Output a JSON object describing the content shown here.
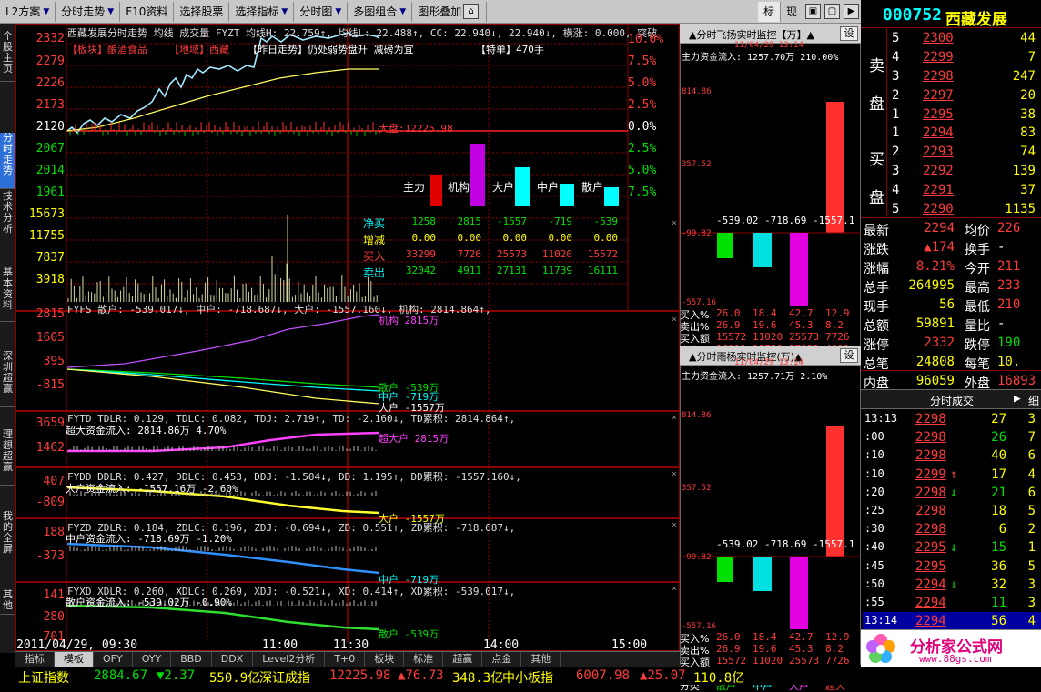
{
  "toolbar": {
    "items": [
      "L2方案",
      "分时走势",
      "F10资料",
      "选择股票",
      "选择指标",
      "分时图",
      "多图组合",
      "图形叠加"
    ],
    "right": [
      "标",
      "现"
    ]
  },
  "lefttabs": [
    "个股主页",
    "分时走势",
    "技术分析",
    "基本资料",
    "深圳超赢",
    "理想超赢",
    "我的全屏",
    "其他"
  ],
  "chart": {
    "header": "西藏发展分时走势  均线  成交量  FYZT  均线H: 22.759↑, 均线L: 22.488↑, CC: 22.940↓, 22.940↓, 横涨: 0.000, 突破",
    "tags": [
      "【板块】酿酒食品",
      "【地域】西藏",
      "【昨日走势】仍处弱势盘升  减磅为宜",
      "【特单】470手"
    ],
    "ylabels": [
      "2332",
      "2279",
      "2226",
      "2173",
      "2120",
      "2067",
      "2014",
      "1961"
    ],
    "pct": [
      "10.0%",
      "7.5%",
      "5.0%",
      "2.5%",
      "0.0%",
      "2.5%",
      "5.0%",
      "7.5%"
    ],
    "dapan": "大盘:12225.98",
    "vol_labels": [
      "15673",
      "11755",
      "7837",
      "3918"
    ],
    "bar_labels": [
      "主力",
      "机构",
      "大户",
      "中户",
      "散户"
    ],
    "flow": {
      "rows": [
        {
          "label": "净买",
          "vals": [
            "1258",
            "2815",
            "-1557",
            "-719",
            "-539"
          ]
        },
        {
          "label": "增减",
          "vals": [
            "0.00",
            "0.00",
            "0.00",
            "0.00",
            "0.00"
          ]
        },
        {
          "label": "买入",
          "vals": [
            "33299",
            "7726",
            "25573",
            "11020",
            "15572"
          ]
        },
        {
          "label": "卖出",
          "vals": [
            "32042",
            "4911",
            "27131",
            "11739",
            "16111"
          ]
        }
      ]
    },
    "times": [
      "2011/04/29, 09:30",
      "11:00",
      "11:30",
      "14:00",
      "15:00"
    ]
  },
  "ind1": {
    "header": "FYFS 散户: -539.017↓, 中户: -718.687↓, 大户: -1557.160↓, 机构: 2814.864↑,",
    "ylabels": [
      "2815",
      "1605",
      "395",
      "-815"
    ],
    "labels": [
      "机构 2815万",
      "散户 -539万",
      "中户 -719万",
      "大户 -1557万"
    ]
  },
  "ind2": {
    "header": "FYTD TDLR: 0.129, TDLC: 0.082, TDJ: 2.719↑, TD: -2.160↓, TD累积: 2814.864↑,",
    "sub": "超大资金流入: 2814.86万   4.70%",
    "ylabels": [
      "3659",
      "1462"
    ],
    "label": "超大户 2815万"
  },
  "ind3": {
    "header": "FYDD DDLR: 0.427, DDLC: 0.453, DDJ: -1.504↓, DD: 1.195↑, DD累积: -1557.160↓,",
    "sub": "大户资金流入: -1557.16万  -2.60%",
    "ylabels": [
      "407",
      "-809"
    ],
    "label": "大户 -1557万"
  },
  "ind4": {
    "header": "FYZD ZDLR: 0.184, ZDLC: 0.196, ZDJ: -0.694↓, ZD: 0.551↑, ZD累积: -718.687↓,",
    "sub": "中户资金流入: -718.69万  -1.20%",
    "ylabels": [
      "188",
      "-373"
    ],
    "label": "中户 -719万"
  },
  "ind5": {
    "header": "FYXD XDLR: 0.260, XDLC: 0.269, XDJ: -0.521↓, XD: 0.414↑, XD累积: -539.017↓,",
    "sub": "散户资金流入: -539.02万  -0.90%",
    "ylabels": [
      "141",
      "-280",
      "-701"
    ],
    "label": "散户 -539万"
  },
  "monitor": [
    {
      "title": "▲分时飞扬实时监控【万】▲",
      "set": "设",
      "sub1": "主力资金流入: 1257.70万   210.00%",
      "sub2": "11/04/29 13:14",
      "ymax": "814.86",
      "ymid": "357.52",
      "yzero": "-99.82",
      "ymin": "-557.16",
      "negvals": [
        "-539.02",
        "-718.69",
        "-1557.1"
      ],
      "rows": [
        {
          "label": "买入%",
          "vals": [
            "26.0",
            "18.4",
            "42.7",
            "12.9"
          ]
        },
        {
          "label": "卖出%",
          "vals": [
            "26.9",
            "19.6",
            "45.3",
            "8.2"
          ]
        },
        {
          "label": "买入额",
          "vals": [
            "15572",
            "11020",
            "25573",
            "7726"
          ]
        },
        {
          "label": "卖出额",
          "vals": [
            "16111",
            "11739",
            "27131",
            "4911"
          ]
        },
        {
          "label": "分类",
          "vals": [
            "散户",
            "中户",
            "大户",
            "超大"
          ]
        }
      ]
    },
    {
      "title": "▲分时雨杨实时监控(万)▲",
      "set": "设",
      "sub1": "主力资金流入: 1257.71万   2.10%",
      "sub2": "11/04/29 13:14",
      "ymax": "814.86",
      "ymid": "357.52",
      "yzero": "-99.82",
      "ymin": "-557.16",
      "negvals": [
        "-539.02",
        "-718.69",
        "-1557.1"
      ],
      "rows": [
        {
          "label": "买入%",
          "vals": [
            "26.0",
            "18.4",
            "42.7",
            "12.9"
          ]
        },
        {
          "label": "卖出%",
          "vals": [
            "26.9",
            "19.6",
            "45.3",
            "8.2"
          ]
        },
        {
          "label": "买入额",
          "vals": [
            "15572",
            "11020",
            "25573",
            "7726"
          ]
        },
        {
          "label": "卖出额",
          "vals": [
            "16111",
            "11739",
            "27130",
            "4911"
          ]
        },
        {
          "label": "分类",
          "vals": [
            "散户",
            "中户",
            "大户",
            "超大"
          ]
        }
      ]
    }
  ],
  "stock": {
    "code": "000752",
    "name": "西藏发展",
    "sell": [
      {
        "n": "5",
        "p": "2300",
        "v": "44"
      },
      {
        "n": "4",
        "p": "2299",
        "v": "7"
      },
      {
        "n": "3",
        "p": "2298",
        "v": "247"
      },
      {
        "n": "2",
        "p": "2297",
        "v": "20"
      },
      {
        "n": "1",
        "p": "2295",
        "v": "38"
      }
    ],
    "sell_label": [
      "卖",
      "盘"
    ],
    "buy": [
      {
        "n": "1",
        "p": "2294",
        "v": "83"
      },
      {
        "n": "2",
        "p": "2293",
        "v": "74"
      },
      {
        "n": "3",
        "p": "2292",
        "v": "139"
      },
      {
        "n": "4",
        "p": "2291",
        "v": "37"
      },
      {
        "n": "5",
        "p": "2290",
        "v": "1135"
      }
    ],
    "buy_label": [
      "买",
      "盘"
    ],
    "stats": [
      {
        "k1": "最新",
        "v1": "2294",
        "k2": "均价",
        "v2": "226"
      },
      {
        "k1": "涨跌",
        "v1": "▲174",
        "k2": "换手",
        "v2": "-"
      },
      {
        "k1": "涨幅",
        "v1": "8.21%",
        "k2": "今开",
        "v2": "211"
      },
      {
        "k1": "总手",
        "v1": "264995",
        "k2": "最高",
        "v2": "233"
      },
      {
        "k1": "现手",
        "v1": "56",
        "k2": "最低",
        "v2": "210"
      },
      {
        "k1": "总额",
        "v1": "59891",
        "k2": "量比",
        "v2": "-"
      },
      {
        "k1": "涨停",
        "v1": "2332",
        "k2": "跌停",
        "v2": "190"
      },
      {
        "k1": "总笔",
        "v1": "24808",
        "k2": "每笔",
        "v2": "10."
      },
      {
        "k1": "内盘",
        "v1": "96059",
        "k2": "外盘",
        "v2": "16893"
      }
    ],
    "ticks_title": "分时成交",
    "ticks_extra": "细",
    "ticks": [
      {
        "t": "13:13",
        "p": "2298",
        "a": "",
        "v": "27",
        "n": "3"
      },
      {
        "t": ":00",
        "p": "2298",
        "a": "",
        "v": "26",
        "n": "7"
      },
      {
        "t": ":10",
        "p": "2298",
        "a": "",
        "v": "40",
        "n": "6"
      },
      {
        "t": ":10",
        "p": "2299",
        "a": "↑",
        "v": "17",
        "n": "4"
      },
      {
        "t": ":20",
        "p": "2298",
        "a": "↓",
        "v": "21",
        "n": "6"
      },
      {
        "t": ":25",
        "p": "2298",
        "a": "",
        "v": "18",
        "n": "5"
      },
      {
        "t": ":30",
        "p": "2298",
        "a": "",
        "v": "6",
        "n": "2"
      },
      {
        "t": ":40",
        "p": "2295",
        "a": "↓",
        "v": "15",
        "n": "1"
      },
      {
        "t": ":45",
        "p": "2295",
        "a": "",
        "v": "36",
        "n": "5"
      },
      {
        "t": ":50",
        "p": "2294",
        "a": "↓",
        "v": "32",
        "n": "3"
      },
      {
        "t": ":55",
        "p": "2294",
        "a": "",
        "v": "11",
        "n": "3"
      },
      {
        "t": "13:14",
        "p": "2294",
        "a": "",
        "v": "56",
        "n": "4"
      }
    ]
  },
  "btabs": [
    "指标",
    "模板",
    "OFY",
    "OYY",
    "BBD",
    "DDX",
    "Level2分析",
    "T+0",
    "板块",
    "标准",
    "超赢",
    "点金",
    "其他"
  ],
  "status": {
    "items": [
      {
        "name": "上证指数",
        "val": "2884.67",
        "chg": "▼2.37",
        "amt": "550.9亿"
      },
      {
        "name": "深证成指",
        "val": "12225.98",
        "chg": "▲76.73",
        "amt": "348.3亿"
      },
      {
        "name": "中小板指",
        "val": "6007.98",
        "chg": "▲25.07",
        "amt": "110.8亿"
      }
    ]
  },
  "logo": {
    "text": "分析家公式网",
    "url": "www.88gs.com"
  },
  "colors": {
    "up": "#ff3b3b",
    "down": "#00e000",
    "grid": "#8b0000",
    "accent": "#00ffff"
  }
}
